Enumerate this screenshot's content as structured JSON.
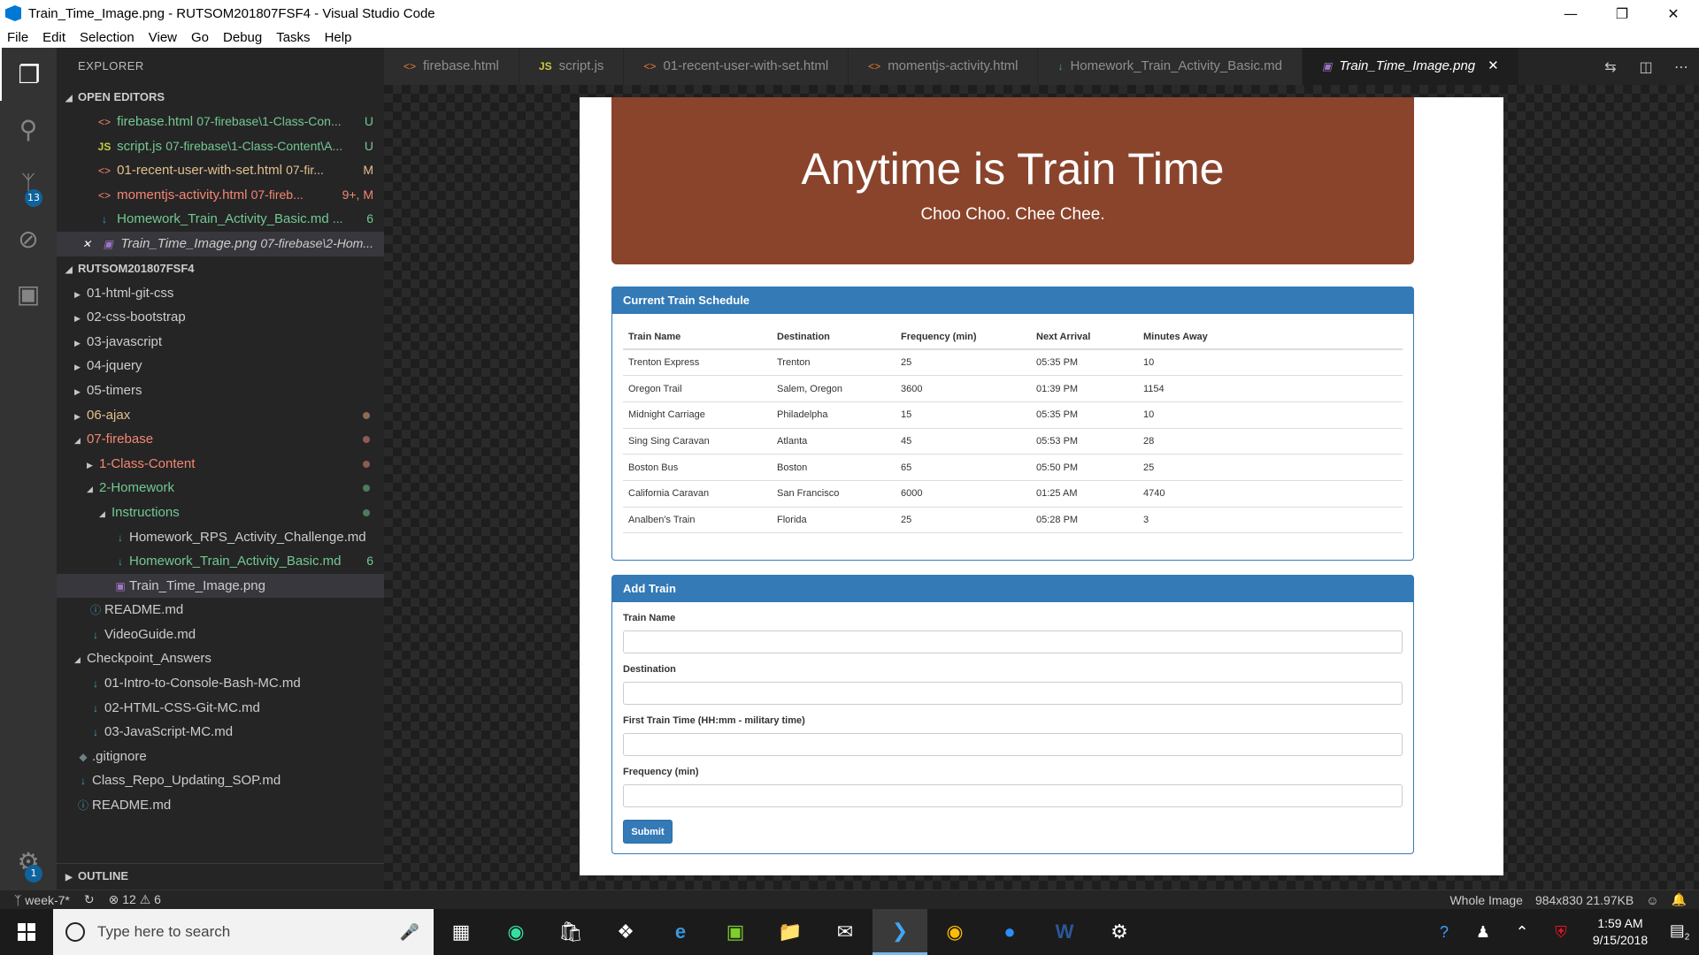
{
  "window": {
    "title": "Train_Time_Image.png - RUTSOM201807FSF4 - Visual Studio Code"
  },
  "menu": [
    "File",
    "Edit",
    "Selection",
    "View",
    "Go",
    "Debug",
    "Tasks",
    "Help"
  ],
  "activity": {
    "scm_badge": "13",
    "settings_badge": "1"
  },
  "sidebar": {
    "title": "EXPLORER",
    "open_editors_label": "OPEN EDITORS",
    "open_editors": [
      {
        "name": "firebase.html",
        "path": "07-firebase\\1-Class-Con...",
        "status": "U",
        "icon": "<>"
      },
      {
        "name": "script.js",
        "path": "07-firebase\\1-Class-Content\\A...",
        "status": "U",
        "icon": "JS"
      },
      {
        "name": "01-recent-user-with-set.html",
        "path": "07-fir...",
        "status": "M",
        "icon": "<>"
      },
      {
        "name": "momentjs-activity.html",
        "path": "07-fireb...",
        "status": "9+, M",
        "icon": "<>"
      },
      {
        "name": "Homework_Train_Activity_Basic.md",
        "path": "...",
        "status": "6",
        "icon": "↓"
      },
      {
        "name": "Train_Time_Image.png",
        "path": "07-firebase\\2-Hom...",
        "status": "",
        "icon": "▣"
      }
    ],
    "workspace_label": "RUTSOM201807FSF4",
    "tree": [
      "01-html-git-css",
      "02-css-bootstrap",
      "03-javascript",
      "04-jquery",
      "05-timers",
      "06-ajax",
      "07-firebase",
      "1-Class-Content",
      "2-Homework",
      "Instructions",
      "Homework_RPS_Activity_Challenge.md",
      "Homework_Train_Activity_Basic.md",
      "Train_Time_Image.png",
      "README.md",
      "VideoGuide.md",
      "Checkpoint_Answers",
      "01-Intro-to-Console-Bash-MC.md",
      "02-HTML-CSS-Git-MC.md",
      "03-JavaScript-MC.md",
      ".gitignore",
      "Class_Repo_Updating_SOP.md",
      "README.md"
    ],
    "tree_badge": "6",
    "outline_label": "OUTLINE"
  },
  "tabs": [
    {
      "label": "firebase.html",
      "icon": "<>"
    },
    {
      "label": "script.js",
      "icon": "JS"
    },
    {
      "label": "01-recent-user-with-set.html",
      "icon": "<>"
    },
    {
      "label": "momentjs-activity.html",
      "icon": "<>"
    },
    {
      "label": "Homework_Train_Activity_Basic.md",
      "icon": "↓"
    },
    {
      "label": "Train_Time_Image.png",
      "icon": "▣"
    }
  ],
  "preview": {
    "heading": "Anytime is Train Time",
    "subheading": "Choo Choo. Chee Chee.",
    "schedule_title": "Current Train Schedule",
    "columns": [
      "Train Name",
      "Destination",
      "Frequency (min)",
      "Next Arrival",
      "Minutes Away"
    ],
    "rows": [
      [
        "Trenton Express",
        "Trenton",
        "25",
        "05:35 PM",
        "10"
      ],
      [
        "Oregon Trail",
        "Salem, Oregon",
        "3600",
        "01:39 PM",
        "1154"
      ],
      [
        "Midnight Carriage",
        "Philadelpha",
        "15",
        "05:35 PM",
        "10"
      ],
      [
        "Sing Sing Caravan",
        "Atlanta",
        "45",
        "05:53 PM",
        "28"
      ],
      [
        "Boston Bus",
        "Boston",
        "65",
        "05:50 PM",
        "25"
      ],
      [
        "California Caravan",
        "San Francisco",
        "6000",
        "01:25 AM",
        "4740"
      ],
      [
        "Analben's Train",
        "Florida",
        "25",
        "05:28 PM",
        "3"
      ]
    ],
    "add_title": "Add Train",
    "fields": [
      "Train Name",
      "Destination",
      "First Train Time (HH:mm - military time)",
      "Frequency (min)"
    ],
    "submit": "Submit"
  },
  "status": {
    "branch": "week-7*",
    "errors": "12",
    "warnings": "6",
    "view_mode": "Whole Image",
    "image_info": "984x830 21.97KB"
  },
  "taskbar": {
    "search_placeholder": "Type here to search",
    "time": "1:59 AM",
    "date": "9/15/2018",
    "notif_count": "2"
  }
}
